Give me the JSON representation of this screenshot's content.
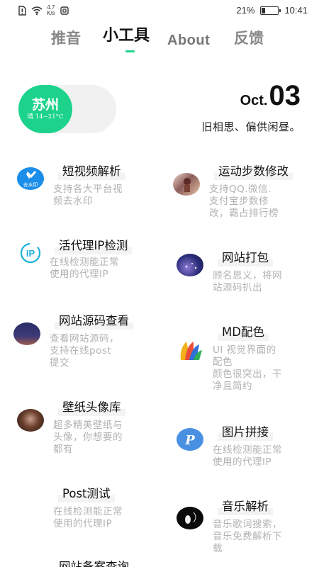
{
  "status_bar": {
    "speed_value": "4.7",
    "speed_unit": "K/s",
    "battery": "21%",
    "battery_level": 0.21,
    "time": "10:41"
  },
  "tabs": [
    {
      "label": "推音"
    },
    {
      "label": "小工具"
    },
    {
      "label": "About"
    },
    {
      "label": "反馈"
    }
  ],
  "accent_color": "#1dd38b",
  "weather": {
    "city": "苏州",
    "summary": "晴 14~21°C"
  },
  "date": {
    "month": "Oct.",
    "day": "03",
    "motto": "旧相思、偏供闲昼。"
  },
  "tools": [
    {
      "title": "短视频解析",
      "desc": [
        "支持各大平台视",
        "频去水印"
      ],
      "icon": "watermark-remove-icon",
      "icon_text": "去水印"
    },
    {
      "title": "运动步数修改",
      "desc": [
        "支持QQ.微信.",
        "支付宝步数修",
        "改，霸占排行榜"
      ],
      "icon": "runner-photo-icon"
    },
    {
      "title": "活代理IP检测",
      "desc": [
        "在线检测能正常",
        "使用的代理IP"
      ],
      "icon": "ip-icon",
      "icon_text": "IP"
    },
    {
      "title": "网站打包",
      "desc": [
        "顾名思义，将网",
        "站源码扒出"
      ],
      "icon": "city-night-icon"
    },
    {
      "title": "网站源码查看",
      "desc": [
        "查看网站源码，",
        "支持在线post",
        "提交"
      ],
      "icon": "night-sky-icon"
    },
    {
      "title": "MD配色",
      "desc": [
        "UI 视觉界面的",
        "配色",
        "颜色很突出，干",
        "净且简约"
      ],
      "icon": "palette-icon"
    },
    {
      "title": "壁纸头像库",
      "desc": [
        "超多精美壁纸与",
        "头像，你想要的",
        "都有"
      ],
      "icon": "portrait-photo-icon"
    },
    {
      "title": "图片拼接",
      "desc": [
        "在线检测能正常",
        "使用的代理IP"
      ],
      "icon": "p-letter-icon",
      "icon_text": "P"
    },
    {
      "title": "Post测试",
      "desc": [
        "在线检测能正常",
        "使用的代理IP"
      ],
      "icon": "none"
    },
    {
      "title": "音乐解析",
      "desc": [
        "音乐歌词搜索，",
        "音乐免费解析下",
        "载"
      ],
      "icon": "music-art-icon"
    },
    {
      "title": "网站备案查询",
      "desc": [],
      "icon": "none"
    }
  ]
}
